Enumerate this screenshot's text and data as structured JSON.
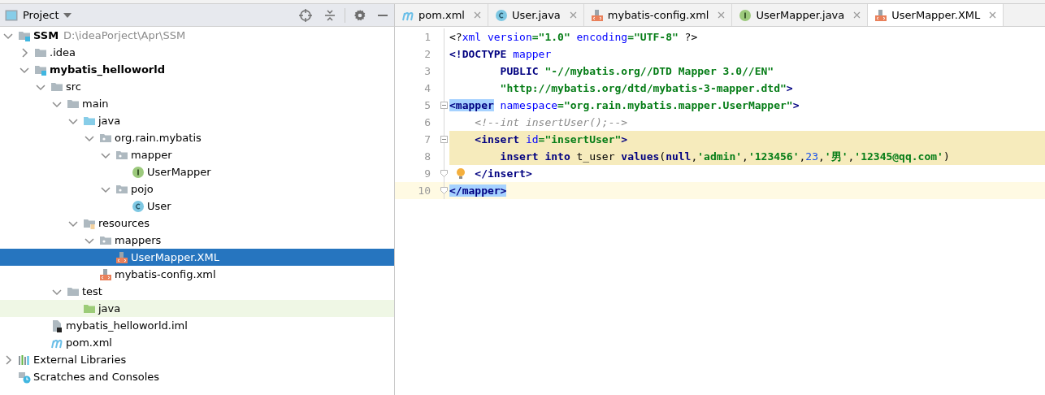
{
  "project_panel": {
    "title": "Project",
    "tree": [
      {
        "label": "SSM",
        "path": "D:\\ideaPorject\\Apr\\SSM",
        "kind": "module",
        "bold": true,
        "expanded": true,
        "selected": false,
        "highlighted": false,
        "children": [
          {
            "label": ".idea",
            "kind": "folder",
            "expanded": false,
            "selected": false,
            "highlighted": false
          },
          {
            "label": "mybatis_helloworld",
            "kind": "module",
            "bold": true,
            "expanded": true,
            "selected": false,
            "highlighted": false,
            "children": [
              {
                "label": "src",
                "kind": "folder",
                "expanded": true,
                "selected": false,
                "highlighted": false,
                "children": [
                  {
                    "label": "main",
                    "kind": "folder",
                    "expanded": true,
                    "selected": false,
                    "highlighted": false,
                    "children": [
                      {
                        "label": "java",
                        "kind": "source",
                        "expanded": true,
                        "selected": false,
                        "highlighted": false,
                        "children": [
                          {
                            "label": "org.rain.mybatis",
                            "kind": "package",
                            "expanded": true,
                            "selected": false,
                            "highlighted": false,
                            "children": [
                              {
                                "label": "mapper",
                                "kind": "package",
                                "expanded": true,
                                "selected": false,
                                "highlighted": false,
                                "children": [
                                  {
                                    "label": "UserMapper",
                                    "kind": "interface",
                                    "selected": false,
                                    "highlighted": false
                                  }
                                ]
                              },
                              {
                                "label": "pojo",
                                "kind": "package",
                                "expanded": true,
                                "selected": false,
                                "highlighted": false,
                                "children": [
                                  {
                                    "label": "User",
                                    "kind": "class",
                                    "selected": false,
                                    "highlighted": false
                                  }
                                ]
                              }
                            ]
                          }
                        ]
                      },
                      {
                        "label": "resources",
                        "kind": "resources",
                        "expanded": true,
                        "selected": false,
                        "highlighted": false,
                        "children": [
                          {
                            "label": "mappers",
                            "kind": "package",
                            "expanded": true,
                            "selected": false,
                            "highlighted": false,
                            "children": [
                              {
                                "label": "UserMapper.XML",
                                "kind": "xml",
                                "selected": true,
                                "highlighted": false
                              }
                            ]
                          },
                          {
                            "label": "mybatis-config.xml",
                            "kind": "xml",
                            "selected": false,
                            "highlighted": false
                          }
                        ]
                      }
                    ]
                  },
                  {
                    "label": "test",
                    "kind": "folder",
                    "expanded": true,
                    "selected": false,
                    "highlighted": false,
                    "children": [
                      {
                        "label": "java",
                        "kind": "test",
                        "selected": false,
                        "highlighted": true
                      }
                    ]
                  }
                ]
              },
              {
                "label": "mybatis_helloworld.iml",
                "kind": "iml",
                "selected": false,
                "highlighted": false
              },
              {
                "label": "pom.xml",
                "kind": "maven",
                "selected": false,
                "highlighted": false
              }
            ]
          }
        ]
      },
      {
        "label": "External Libraries",
        "kind": "libraries",
        "expanded": false,
        "selected": false,
        "highlighted": false
      },
      {
        "label": "Scratches and Consoles",
        "kind": "scratches",
        "selected": false,
        "highlighted": false
      }
    ]
  },
  "editor": {
    "tabs": [
      {
        "label": "pom.xml",
        "kind": "maven",
        "selected": false
      },
      {
        "label": "User.java",
        "kind": "class",
        "selected": false
      },
      {
        "label": "mybatis-config.xml",
        "kind": "xml",
        "selected": false
      },
      {
        "label": "UserMapper.java",
        "kind": "interface",
        "selected": false
      },
      {
        "label": "UserMapper.XML",
        "kind": "xml",
        "selected": true
      }
    ],
    "lines": [
      {
        "number": "1",
        "current": false,
        "injected": false,
        "fold_open": false,
        "fold_close": false,
        "bulb": false,
        "tokens": [
          {
            "kind": "text",
            "text": "<?"
          },
          {
            "kind": "attr",
            "text": "xml version"
          },
          {
            "kind": "value",
            "text": "=\"1.0\""
          },
          {
            "kind": "attr",
            "text": " encoding"
          },
          {
            "kind": "value",
            "text": "=\"UTF-8\""
          },
          {
            "kind": "text",
            "text": " ?>"
          }
        ]
      },
      {
        "number": "2",
        "current": false,
        "injected": false,
        "fold_open": false,
        "fold_close": false,
        "bulb": false,
        "tokens": [
          {
            "kind": "tag",
            "text": "<!DOCTYPE"
          },
          {
            "kind": "attr",
            "text": " mapper"
          }
        ]
      },
      {
        "number": "3",
        "current": false,
        "injected": false,
        "fold_open": false,
        "fold_close": false,
        "bulb": false,
        "tokens": [
          {
            "kind": "tag",
            "text": "        PUBLIC "
          },
          {
            "kind": "value",
            "text": "\"-//mybatis.org//DTD Mapper 3.0//EN\""
          }
        ]
      },
      {
        "number": "4",
        "current": false,
        "injected": false,
        "fold_open": false,
        "fold_close": false,
        "bulb": false,
        "tokens": [
          {
            "kind": "value",
            "text": "        \"http://mybatis.org/dtd/mybatis-3-mapper.dtd\""
          },
          {
            "kind": "tag",
            "text": ">"
          }
        ]
      },
      {
        "number": "5",
        "current": false,
        "injected": false,
        "fold_open": true,
        "fold_close": false,
        "bulb": false,
        "tokens": [
          {
            "kind": "tag",
            "text": "<mapper",
            "match": true
          },
          {
            "kind": "attr",
            "text": " namespace"
          },
          {
            "kind": "value",
            "text": "=\"org.rain.mybatis.mapper.UserMapper\""
          },
          {
            "kind": "tag",
            "text": ">"
          }
        ]
      },
      {
        "number": "6",
        "current": false,
        "injected": false,
        "fold_open": false,
        "fold_close": false,
        "bulb": false,
        "tokens": [
          {
            "kind": "comment",
            "text": "    <!--int insertUser();-->"
          }
        ]
      },
      {
        "number": "7",
        "current": false,
        "injected": true,
        "fold_open": true,
        "fold_close": false,
        "bulb": false,
        "tokens": [
          {
            "kind": "tag",
            "text": "    <insert"
          },
          {
            "kind": "attr",
            "text": " id"
          },
          {
            "kind": "value",
            "text": "=\"insertUser\""
          },
          {
            "kind": "tag",
            "text": ">"
          }
        ]
      },
      {
        "number": "8",
        "current": false,
        "injected": true,
        "fold_open": false,
        "fold_close": false,
        "bulb": false,
        "tokens": [
          {
            "kind": "keyword",
            "text": "        insert into "
          },
          {
            "kind": "text",
            "text": "t_user "
          },
          {
            "kind": "keyword",
            "text": "values"
          },
          {
            "kind": "text",
            "text": "("
          },
          {
            "kind": "keyword",
            "text": "null"
          },
          {
            "kind": "text",
            "text": ","
          },
          {
            "kind": "value",
            "text": "'admin'"
          },
          {
            "kind": "text",
            "text": ","
          },
          {
            "kind": "value",
            "text": "'123456'"
          },
          {
            "kind": "text",
            "text": ","
          },
          {
            "kind": "number",
            "text": "23"
          },
          {
            "kind": "text",
            "text": ","
          },
          {
            "kind": "value",
            "text": "'男'"
          },
          {
            "kind": "text",
            "text": ","
          },
          {
            "kind": "value",
            "text": "'12345@qq.com'"
          },
          {
            "kind": "text",
            "text": ")"
          }
        ]
      },
      {
        "number": "9",
        "current": false,
        "injected": false,
        "fold_open": false,
        "fold_close": true,
        "bulb": true,
        "tokens": [
          {
            "kind": "tag",
            "text": "    </insert>"
          }
        ]
      },
      {
        "number": "10",
        "current": true,
        "injected": false,
        "fold_open": false,
        "fold_close": true,
        "bulb": false,
        "tokens": [
          {
            "kind": "tag",
            "text": "</mapper>",
            "match": true
          }
        ]
      }
    ]
  }
}
